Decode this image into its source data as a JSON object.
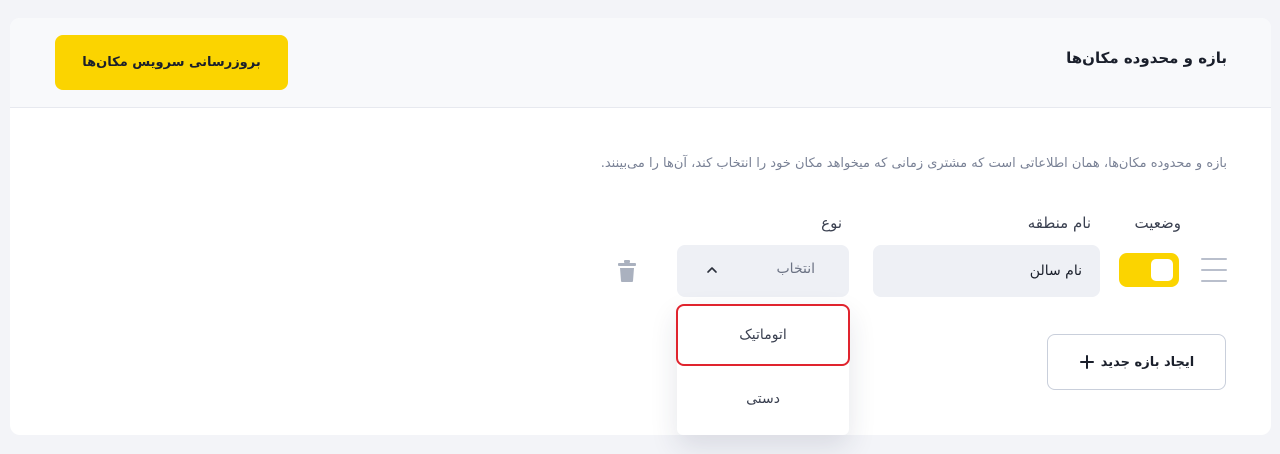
{
  "header": {
    "title": "بازه و محدوده مکان‌ها",
    "update_button": "بروزرسانی سرویس مکان‌ها"
  },
  "description": "بازه و محدوده مکان‌ها، همان اطلاعاتی است که مشتری زمانی که میخواهد مکان خود را انتخاب کند، آن‌ها را می‌بینند.",
  "columns": {
    "status": "وضعیت",
    "area_name": "نام منطقه",
    "type": "نوع"
  },
  "row": {
    "status_on": true,
    "area_name_value": "نام سالن",
    "type_value": "انتخاب"
  },
  "type_dropdown": {
    "options": [
      "اتوماتیک",
      "دستی"
    ],
    "highlighted": "اتوماتیک"
  },
  "create_button": "ایجاد بازه جدید",
  "colors": {
    "accent": "#fbd400",
    "highlight_border": "#e0242e"
  },
  "icons": {
    "drag": "drag-handle-icon",
    "chevron": "chevron-up-icon",
    "trash": "trash-icon",
    "plus": "plus-icon"
  }
}
